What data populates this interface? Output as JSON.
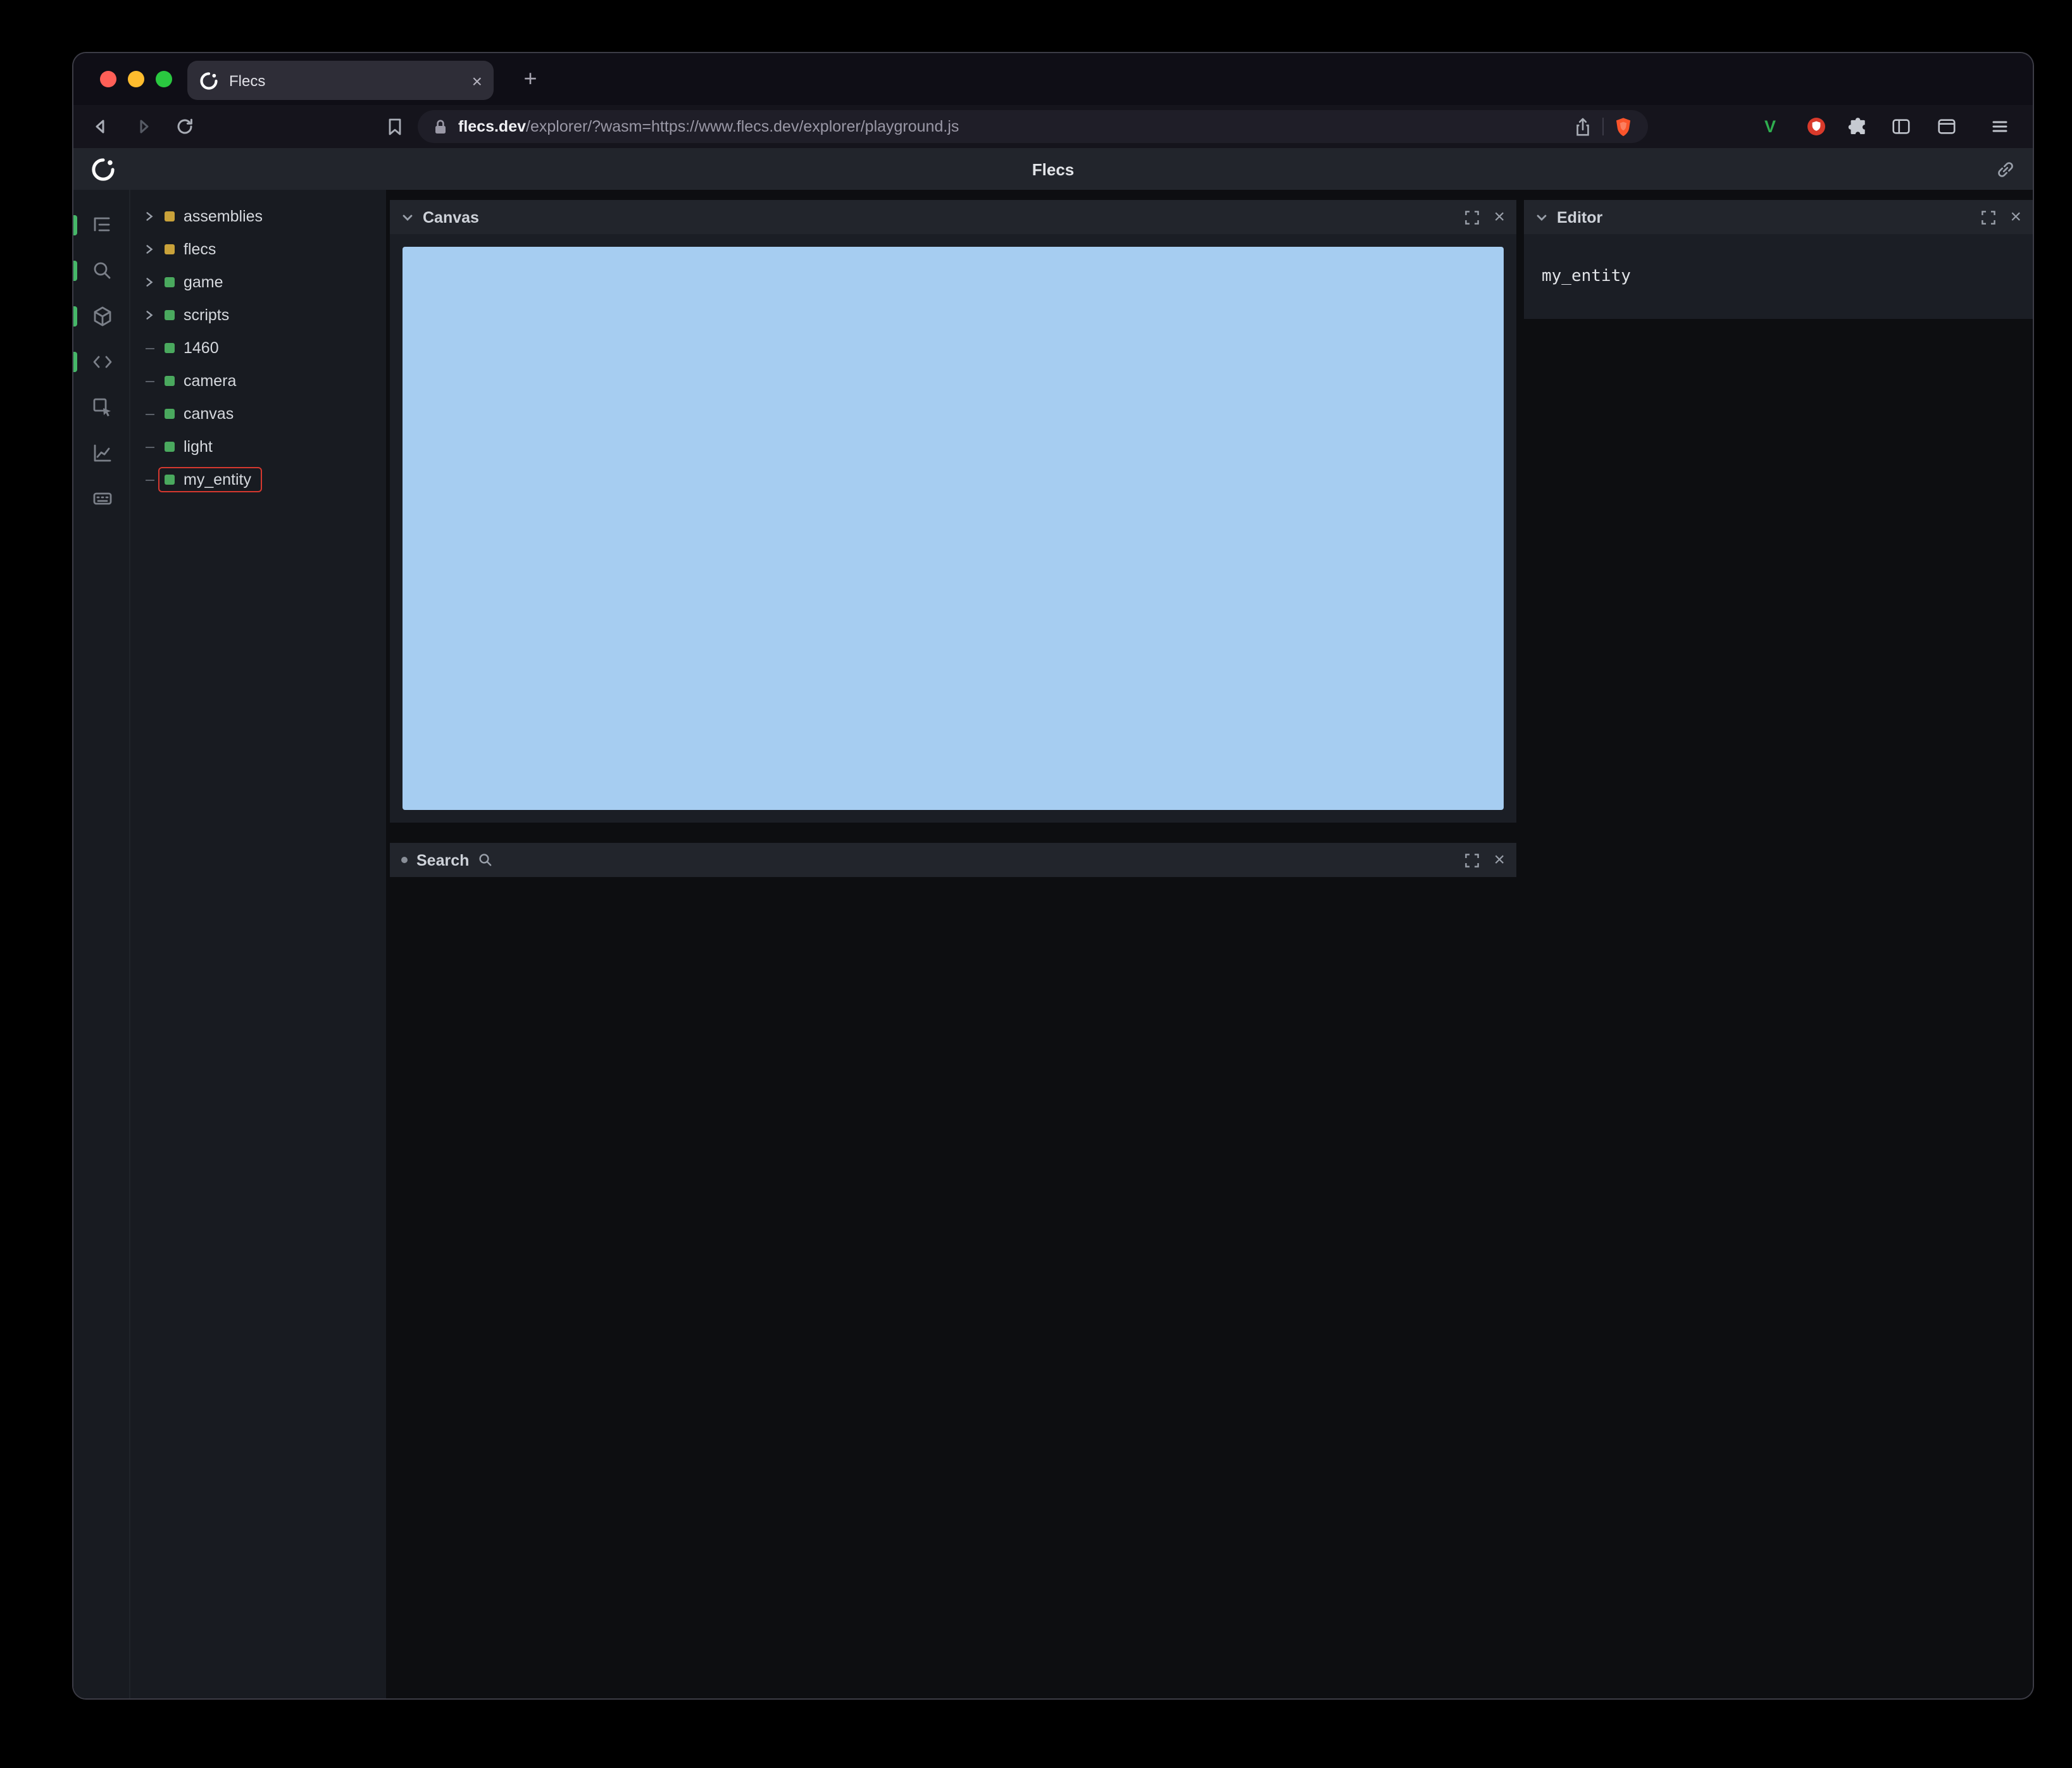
{
  "glyphs": {
    "close": "×",
    "new_tab": "+"
  },
  "colors": {
    "accent_green": "#46b768",
    "module_yellow": "#c9a23a",
    "entity_green": "#4aa95e",
    "selection_red": "#d5382f",
    "canvas_blue": "#a6cdf1"
  },
  "browser": {
    "tab": {
      "title": "Flecs"
    },
    "url": {
      "domain": "flecs.dev",
      "path": "/explorer/?wasm=https://www.flecs.dev/explorer/playground.js"
    },
    "toolbar_icons": {
      "green_v_glyph": "V"
    }
  },
  "app": {
    "header": {
      "title": "Flecs"
    },
    "sidebar": {
      "buttons": [
        {
          "name": "tree",
          "active": true
        },
        {
          "name": "search",
          "active": true
        },
        {
          "name": "entities",
          "active": true
        },
        {
          "name": "code",
          "active": true
        },
        {
          "name": "inspect",
          "active": false
        },
        {
          "name": "stats",
          "active": false
        },
        {
          "name": "console",
          "active": false
        }
      ]
    },
    "tree": {
      "items": [
        {
          "label": "assemblies",
          "kind": "module",
          "expandable": true
        },
        {
          "label": "flecs",
          "kind": "module",
          "expandable": true
        },
        {
          "label": "game",
          "kind": "entity",
          "expandable": true
        },
        {
          "label": "scripts",
          "kind": "entity",
          "expandable": true
        },
        {
          "label": "1460",
          "kind": "entity",
          "expandable": false
        },
        {
          "label": "camera",
          "kind": "entity",
          "expandable": false
        },
        {
          "label": "canvas",
          "kind": "entity",
          "expandable": false
        },
        {
          "label": "light",
          "kind": "entity",
          "expandable": false
        },
        {
          "label": "my_entity",
          "kind": "entity",
          "expandable": false,
          "selected": true
        }
      ]
    },
    "panels": {
      "canvas": {
        "title": "Canvas"
      },
      "search": {
        "title": "Search"
      },
      "editor": {
        "title": "Editor",
        "content": "my_entity"
      }
    }
  }
}
